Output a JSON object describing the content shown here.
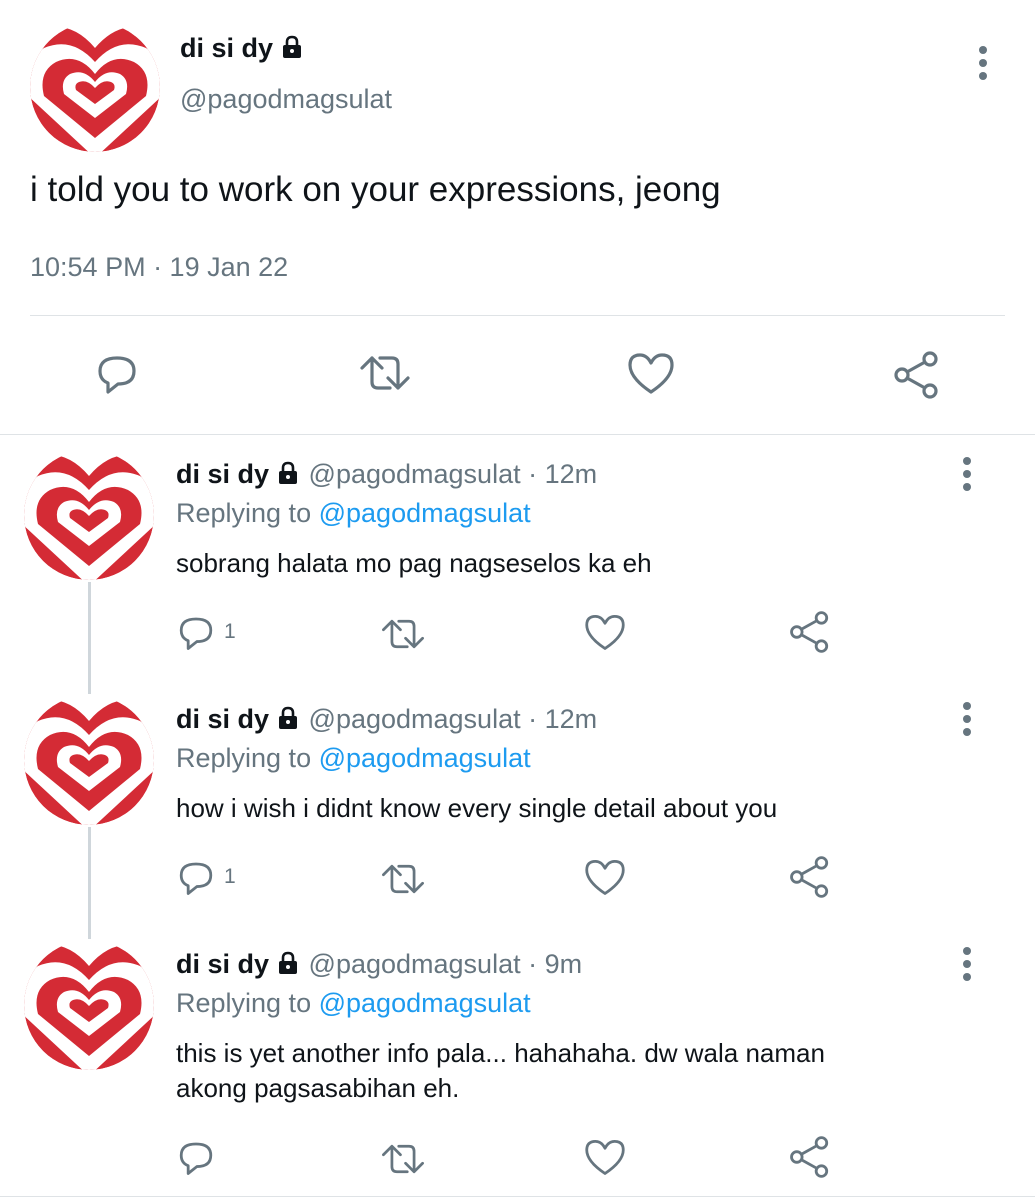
{
  "main_tweet": {
    "display_name": "di si dy",
    "handle": "@pagodmagsulat",
    "text": "i told you to work on your expressions, jeong",
    "timestamp": "10:54 PM · 19 Jan 22",
    "icons": [
      "reply-icon",
      "retweet-icon",
      "like-icon",
      "share-icon",
      "more-icon",
      "lock-icon"
    ]
  },
  "replies": [
    {
      "display_name": "di si dy",
      "handle": "@pagodmagsulat",
      "separator": "·",
      "time": "12m",
      "replying_prefix": "Replying to",
      "replying_to": "@pagodmagsulat",
      "text": "sobrang halata mo pag nagseselos ka eh",
      "text_line2": "",
      "reply_count": "1"
    },
    {
      "display_name": "di si dy",
      "handle": "@pagodmagsulat",
      "separator": "·",
      "time": "12m",
      "replying_prefix": "Replying to",
      "replying_to": "@pagodmagsulat",
      "text": "how i wish i didnt know every single detail about you",
      "text_line2": "",
      "reply_count": "1"
    },
    {
      "display_name": "di si dy",
      "handle": "@pagodmagsulat",
      "separator": "·",
      "time": "9m",
      "replying_prefix": "Replying to",
      "replying_to": "@pagodmagsulat",
      "text": "this is yet another info pala... hahahaha. dw wala naman",
      "text_line2": "akong pagsasabihan eh.",
      "reply_count": ""
    }
  ],
  "colors": {
    "link": "#1d9bf0",
    "muted": "#66757f",
    "avatar_red": "#d42b35"
  }
}
